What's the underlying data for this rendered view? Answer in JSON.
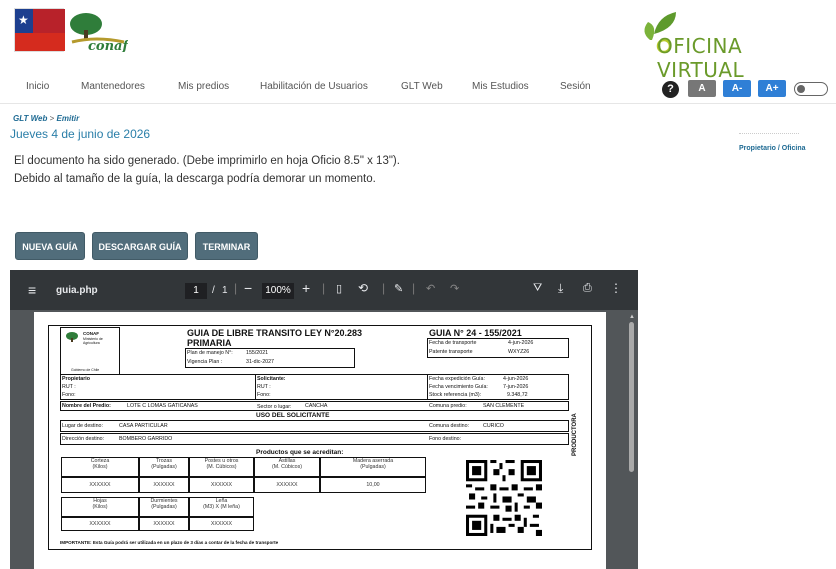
{
  "header": {
    "gov_logo_text": "Ministerio de Agricultura",
    "conaf_logo_text": "conaf",
    "oficina_virtual": "OFICINA VIRTUAL"
  },
  "nav": {
    "items": [
      "Inicio",
      "Mantenedores",
      "Mis predios",
      "Habilitación de Usuarios",
      "GLT Web",
      "Mis Estudios",
      "Sesión"
    ],
    "help": "?",
    "font_normal": "A",
    "font_smaller": "A-",
    "font_larger": "A+"
  },
  "breadcrumb": {
    "parent": "GLT Web",
    "separator": ">",
    "current": "Emitir"
  },
  "date": "Jueves 4 de junio de 2026",
  "user_role": "Propietario / Oficina",
  "messages": {
    "line1": "El documento ha sido generado. (Debe imprimirlo en hoja Oficio 8.5\" x 13\").",
    "line2": "Debido al tamaño de la guía, la descarga podría demorar un momento."
  },
  "buttons": {
    "nueva": "NUEVA GUÍA",
    "descargar": "DESCARGAR GUÍA",
    "terminar": "TERMINAR"
  },
  "pdf_toolbar": {
    "filename": "guia.php",
    "page_current": "1",
    "page_separator": "/",
    "page_total": "1",
    "zoom": "100%"
  },
  "document": {
    "title_line1": "GUIA DE LIBRE TRANSITO LEY N°20.283",
    "title_line2": "PRIMARIA",
    "guia_no": "GUIA N° 24 - 155/2021",
    "logo_label": "CONAF",
    "logo_sub": "Ministerio de Agricultura",
    "logo_footer": "Gobierno de Chile",
    "plan_manejo_label": "Plan de manejo N°:",
    "plan_manejo_value": "155/2021",
    "vigencia_label": "Vigencia Plan :",
    "vigencia_value": "31-dic-2027",
    "fecha_transporte_label": "Fecha de transporte",
    "fecha_transporte_value": "4-jun-2026",
    "patente_label": "Patente transporte",
    "patente_value": "WXYZ26",
    "propietario_label": "Propietario",
    "rut_label": "RUT :",
    "fono_label": "Fono:",
    "solicitante_label": "Solicitante:",
    "fecha_expedicion_label": "Fecha expedición Guía:",
    "fecha_expedicion_value": "4-jun-2026",
    "fecha_vencimiento_label": "Fecha vencimiento Guía:",
    "fecha_vencimiento_value": "7-jun-2026",
    "stock_label": "Stock referencia (m3):",
    "stock_value": "9.348,72",
    "nombre_predio_label": "Nombre del Predio:",
    "nombre_predio_value": "LOTE C LOMAS GATICANAS",
    "sector_label": "Sector o lugar:",
    "sector_value": "CANCHA",
    "comuna_predio_label": "Comuna predio:",
    "comuna_predio_value": "SAN CLEMENTE",
    "uso_solicitante": "USO DEL SOLICITANTE",
    "lugar_destino_label": "Lugar de destino:",
    "lugar_destino_value": "CASA PARTICULAR",
    "comuna_destino_label": "Comuna destino:",
    "comuna_destino_value": "CURICO",
    "direccion_destino_label": "Dirección destino:",
    "direccion_destino_value": "BOMBERO GARRIDO",
    "fono_destino_label": "Fono destino:",
    "productora": "PRODUCTORA",
    "productos_title": "Productos que se acreditan:",
    "productos_row1_headers": [
      {
        "name": "Corteza",
        "unit": "(Kilos)",
        "value": "XXXXXX"
      },
      {
        "name": "Trozas",
        "unit": "(Pulgadas)",
        "value": "XXXXXX"
      },
      {
        "name": "Postes u otros",
        "unit": "(M. Cúbicos)",
        "value": "XXXXXX"
      },
      {
        "name": "Astillas",
        "unit": "(M. Cúbicos)",
        "value": "XXXXXX"
      },
      {
        "name": "Madera aserrada",
        "unit": "(Pulgadas)",
        "value": "10,00"
      }
    ],
    "productos_row2_headers": [
      {
        "name": "Hojas",
        "unit": "(Kilos)",
        "value": "XXXXXX"
      },
      {
        "name": "Durmientes",
        "unit": "(Pulgadas)",
        "value": "XXXXXX"
      },
      {
        "name": "Leña",
        "unit": "(M3)  X  (M leña)",
        "value": "XXXXXX"
      }
    ],
    "importante": "IMPORTANTE: Esta Guía podrá ser utilizada en un plazo de 3 días a contar de la fecha de transporte"
  }
}
